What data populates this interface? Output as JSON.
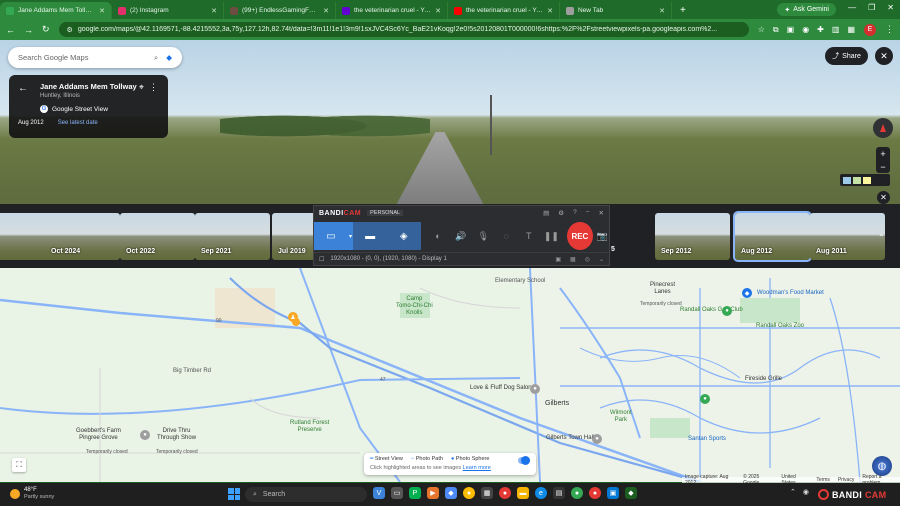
{
  "browser": {
    "tabs": [
      {
        "title": "Jane Addams Mem Tollway - G",
        "color": "#34a853",
        "active": true
      },
      {
        "title": "(2) Instagram",
        "color": "#e1306c",
        "active": false
      },
      {
        "title": "(99+) EndlessGamingFanProdu",
        "color": "#6d4c41",
        "active": false
      },
      {
        "title": "the veterinarian cruel - Yahoo S",
        "color": "#6001d2",
        "active": false
      },
      {
        "title": "the veterinarian cruel - YouTub",
        "color": "#ff0000",
        "active": false
      },
      {
        "title": "New Tab",
        "color": "#9e9e9e",
        "active": false
      }
    ],
    "new_tab_symbol": "+",
    "ask_gemini": "Ask Gemini",
    "url": "google.com/maps/@42.1169571,-88.4215552,3a,75y,127.12h,82.74t/data=!3m11!1e1!3m9!1sxJVC4Sc6Yc_BaE21vKoqg!2e0!5s20120801T000000!6shttps:%2F%2Fstreetviewpixels-pa.googleapis.com%2..."
  },
  "maps": {
    "search_placeholder": "Search Google Maps",
    "info_card": {
      "title": "Jane Addams Mem Tollway",
      "subtitle": "Huntley, Illinois",
      "source": "Google Street View",
      "date": "Aug 2012",
      "latest_link": "See latest date"
    },
    "share_label": "Share",
    "timeline": [
      {
        "label": "",
        "selected": false
      },
      {
        "label": "Oct 2024",
        "selected": false
      },
      {
        "label": "Oct 2022",
        "selected": false
      },
      {
        "label": "Sep 2021",
        "selected": false
      },
      {
        "label": "Jul 2019",
        "selected": false
      },
      {
        "label": "Sep 2012",
        "selected": false
      },
      {
        "label": "Aug 2012",
        "selected": true
      },
      {
        "label": "Aug 2011",
        "selected": false
      }
    ],
    "timeline_partial": "5",
    "map_labels": {
      "camp": "Camp\nTomo-Chi-Chi\nKnolls",
      "elementary": "Elementary School",
      "pinecrest": "Pinecrest\nLanes",
      "pinecrest_sub": "Temporarily closed",
      "woodman": "Woodman's Food Market",
      "randall_oaks_golf": "Randall Oaks Golf Club",
      "randall_oaks_zoo": "Randall Oaks Zoo",
      "fireside": "Fireside Grille",
      "big_timber": "Big Timber Rd",
      "rutland": "Rutland Forest\nPreserve",
      "love_fluff": "Love & Fluff Dog Salon",
      "gilberts": "Gilberts",
      "gilberts_town": "Gilberts Town Hall",
      "wilmont": "Wilmont\nPark",
      "santan": "Santan Sports",
      "goebbert": "Goebbert's Farm\nPingree Grove",
      "goebbert_sub": "Temporarily closed",
      "drive_thru": "Drive Thru\nThrough Show",
      "drive_sub": "Temporarily closed",
      "hwy_90": "90",
      "hwy_47": "47"
    },
    "legend": {
      "street_view": "Street View",
      "photo_path": "Photo Path",
      "photo_sphere": "Photo Sphere",
      "hint": "Click highlighted areas to see images",
      "learn_more": "Learn more"
    },
    "attribution": [
      "Image capture: Aug 2012",
      "© 2025 Google",
      "United States",
      "Terms",
      "Privacy",
      "Report a problem"
    ]
  },
  "bandicam": {
    "logo_a": "BANDI",
    "logo_b": "CAM",
    "edition": "PERSONAL",
    "rec_label": "REC",
    "resolution": "1920x1080 - (0, 0), (1920, 1080) - Display 1"
  },
  "taskbar": {
    "weather_temp": "48°F",
    "weather_desc": "Partly sunny",
    "search_placeholder": "Search",
    "bandicam_tray_a": "BANDI",
    "bandicam_tray_b": "CAM"
  }
}
